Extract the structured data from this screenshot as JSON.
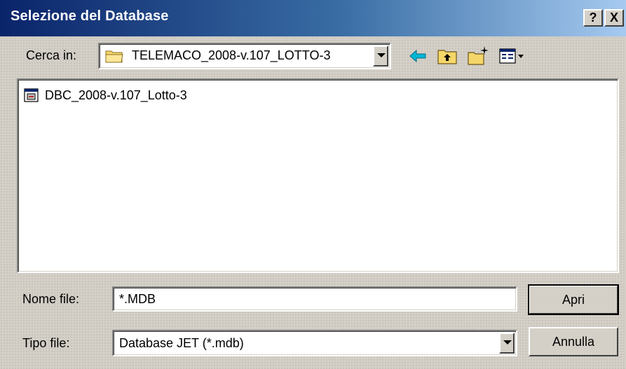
{
  "window": {
    "title": "Selezione del Database",
    "help_label": "?",
    "close_label": "X"
  },
  "lookin": {
    "label": "Cerca in:",
    "value": "TELEMACO_2008-v.107_LOTTO-3"
  },
  "toolbar": {
    "back_icon": "back-arrow-icon",
    "up_icon": "up-folder-icon",
    "newfolder_icon": "new-folder-icon",
    "views_icon": "view-menu-icon"
  },
  "files": [
    {
      "name": "DBC_2008-v.107_Lotto-3",
      "icon": "database-file-icon"
    }
  ],
  "filename": {
    "label": "Nome file:",
    "value": "*.MDB"
  },
  "filetype": {
    "label": "Tipo file:",
    "value": "Database JET (*.mdb)"
  },
  "buttons": {
    "open_label": "Apri",
    "cancel_label": "Annulla"
  },
  "colors": {
    "titlebar_start": "#0a246a",
    "titlebar_end": "#a6caf0",
    "face": "#d4d0c8"
  }
}
